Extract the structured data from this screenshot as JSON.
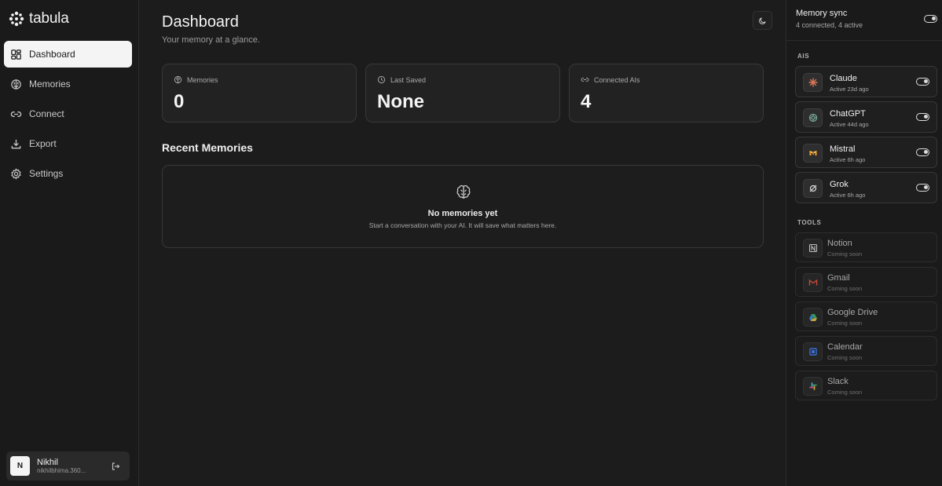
{
  "app": {
    "name": "tabula"
  },
  "sidebar": {
    "items": [
      {
        "label": "Dashboard",
        "icon": "dashboard-icon",
        "active": true
      },
      {
        "label": "Memories",
        "icon": "brain-icon"
      },
      {
        "label": "Connect",
        "icon": "link-icon"
      },
      {
        "label": "Export",
        "icon": "download-icon"
      },
      {
        "label": "Settings",
        "icon": "gear-icon"
      }
    ],
    "user": {
      "initial": "N",
      "name": "Nikhil",
      "email": "nikhilbhima.360..."
    }
  },
  "main": {
    "title": "Dashboard",
    "subtitle": "Your memory at a glance.",
    "stats": [
      {
        "label": "Memories",
        "value": "0",
        "icon": "brain-icon"
      },
      {
        "label": "Last Saved",
        "value": "None",
        "icon": "clock-icon"
      },
      {
        "label": "Connected AIs",
        "value": "4",
        "icon": "link-icon"
      }
    ],
    "recent_title": "Recent Memories",
    "empty": {
      "title": "No memories yet",
      "description": "Start a conversation with your AI. It will save what matters here."
    }
  },
  "panel": {
    "sync": {
      "title": "Memory sync",
      "subtitle": "4 connected, 4 active",
      "enabled": true
    },
    "ais_label": "AIS",
    "ais": [
      {
        "name": "Claude",
        "status": "Active 23d ago",
        "enabled": true,
        "icon": "claude-icon",
        "color": "#d97757"
      },
      {
        "name": "ChatGPT",
        "status": "Active 44d ago",
        "enabled": true,
        "icon": "chatgpt-icon",
        "color": "#7fb8a4"
      },
      {
        "name": "Mistral",
        "status": "Active 6h ago",
        "enabled": true,
        "icon": "mistral-icon",
        "color": "#f0a030"
      },
      {
        "name": "Grok",
        "status": "Active 6h ago",
        "enabled": true,
        "icon": "grok-icon",
        "color": "#dddddd"
      }
    ],
    "tools_label": "TOOLS",
    "tools": [
      {
        "name": "Notion",
        "status": "Coming soon",
        "icon": "notion-icon",
        "color": "#bbbbbb"
      },
      {
        "name": "Gmail",
        "status": "Coming soon",
        "icon": "gmail-icon",
        "color": "#c44a3a"
      },
      {
        "name": "Google Drive",
        "status": "Coming soon",
        "icon": "google-drive-icon",
        "color": "#3a9a55"
      },
      {
        "name": "Calendar",
        "status": "Coming soon",
        "icon": "calendar-icon",
        "color": "#3b6fd1"
      },
      {
        "name": "Slack",
        "status": "Coming soon",
        "icon": "slack-icon",
        "color": "#c8a040"
      }
    ]
  }
}
